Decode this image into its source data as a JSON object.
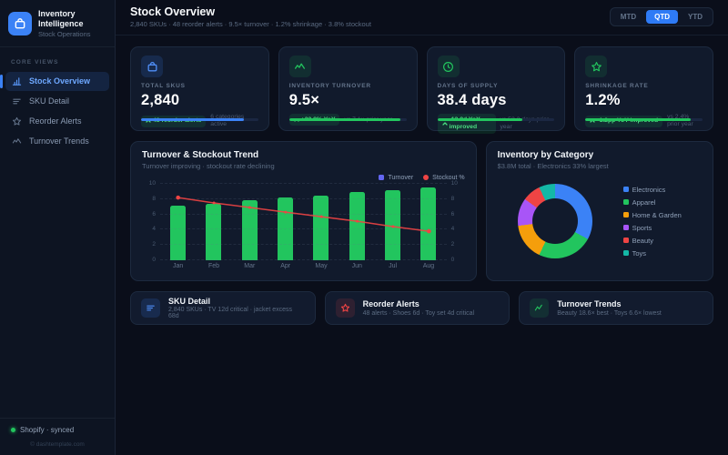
{
  "brand": {
    "title": "Inventory Intelligence",
    "subtitle": "Stock Operations"
  },
  "sidebar": {
    "section_label": "CORE VIEWS",
    "items": [
      {
        "label": "Stock Overview",
        "icon": "bar-chart-icon",
        "active": true
      },
      {
        "label": "SKU Detail",
        "icon": "list-icon",
        "active": false
      },
      {
        "label": "Reorder Alerts",
        "icon": "star-icon",
        "active": false
      },
      {
        "label": "Turnover Trends",
        "icon": "trend-icon",
        "active": false
      }
    ],
    "footer": {
      "status": "Shopify · synced",
      "copyright": "© dashtemplate.com"
    }
  },
  "header": {
    "title": "Stock Overview",
    "subtitle": "2,840 SKUs · 48 reorder alerts · 9.5× turnover · 1.2% shrinkage · 3.8% stockout",
    "range_buttons": [
      {
        "label": "MTD",
        "active": false
      },
      {
        "label": "QTD",
        "active": true
      },
      {
        "label": "YTD",
        "active": false
      }
    ]
  },
  "kpis": [
    {
      "label": "TOTAL SKUS",
      "value": "2,840",
      "badge": "48 reorder alerts",
      "note": "6 categories active",
      "progress": 88,
      "accent": "#3b82f6",
      "icon": "briefcase-icon"
    },
    {
      "label": "INVENTORY TURNOVER",
      "value": "9.5×",
      "badge": "+33.8% YoY",
      "note": "vs 7.1× prior year",
      "progress": 95,
      "accent": "#22c55e",
      "icon": "trend-icon"
    },
    {
      "label": "DAYS OF SUPPLY",
      "value": "38.4 days",
      "badge": "-13.8d YoY improved",
      "note": "vs 52.2 days prior year",
      "progress": 73,
      "accent": "#22c55e",
      "icon": "clock-icon"
    },
    {
      "label": "SHRINKAGE RATE",
      "value": "1.2%",
      "badge": "-1.2pp YoY improved",
      "note": "vs 2.4% prior year",
      "progress": 90,
      "accent": "#22c55e",
      "icon": "star-icon"
    }
  ],
  "chart_data": [
    {
      "type": "bar",
      "title": "Turnover & Stockout Trend",
      "subtitle": "Turnover improving · stockout rate declining",
      "categories": [
        "Jan",
        "Feb",
        "Mar",
        "Apr",
        "May",
        "Jun",
        "Jul",
        "Aug"
      ],
      "series": [
        {
          "name": "Turnover",
          "type": "bar",
          "color": "#22c55e",
          "legend_color": "#6366f1",
          "values": [
            7.1,
            7.4,
            7.8,
            8.2,
            8.5,
            8.9,
            9.2,
            9.5
          ]
        },
        {
          "name": "Stockout %",
          "type": "line",
          "color": "#ef4444",
          "values": [
            8.2,
            7.5,
            6.9,
            6.3,
            5.7,
            5.1,
            4.4,
            3.8
          ]
        }
      ],
      "ylim": [
        0,
        10
      ],
      "y2lim": [
        0,
        10
      ],
      "yticks": [
        0,
        2,
        4,
        6,
        8,
        10
      ],
      "grid": true,
      "legend_position": "top-right"
    },
    {
      "type": "pie",
      "donut": true,
      "title": "Inventory by Category",
      "subtitle": "$3.8M total · Electronics 33% largest",
      "labels": [
        "Electronics",
        "Apparel",
        "Home & Garden",
        "Sports",
        "Beauty",
        "Toys"
      ],
      "values": [
        33,
        24,
        16,
        12,
        8,
        7
      ],
      "colors": [
        "#3b82f6",
        "#22c55e",
        "#f59e0b",
        "#a855f7",
        "#ef4444",
        "#14b8a6"
      ],
      "legend_position": "right"
    }
  ],
  "bottom_cards": [
    {
      "title": "SKU Detail",
      "subtitle": "2,840 SKUs · TV 12d critical · jacket excess 68d",
      "icon": "list-icon",
      "accent": "#3b82f6"
    },
    {
      "title": "Reorder Alerts",
      "subtitle": "48 alerts · Shoes 6d · Toy set 4d critical",
      "icon": "star-icon",
      "accent": "#ef4444"
    },
    {
      "title": "Turnover Trends",
      "subtitle": "Beauty 18.6× best · Toys 6.6× lowest",
      "icon": "trend-icon",
      "accent": "#22c55e"
    }
  ]
}
